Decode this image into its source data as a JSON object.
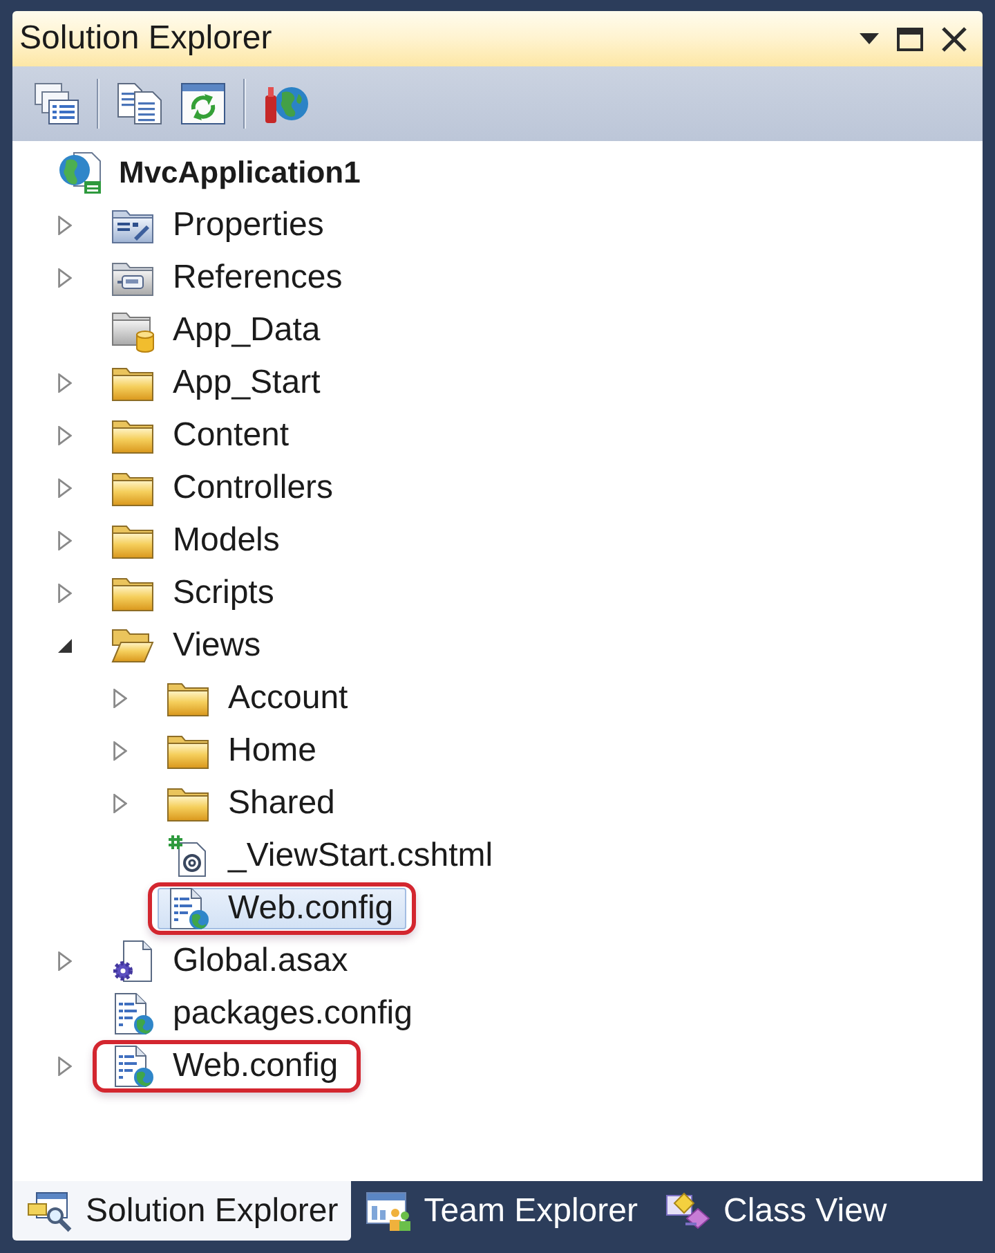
{
  "title_bar": {
    "title": "Solution Explorer"
  },
  "tree": {
    "label": "MvcApplication1",
    "kind": "project",
    "selected": false,
    "highlighted": false,
    "children": [
      {
        "label": "Properties",
        "kind": "properties",
        "expanded": false,
        "selected": false,
        "highlighted": false
      },
      {
        "label": "References",
        "kind": "references",
        "expanded": false,
        "selected": false,
        "highlighted": false
      },
      {
        "label": "App_Data",
        "kind": "data-folder",
        "selected": false,
        "highlighted": false
      },
      {
        "label": "App_Start",
        "kind": "folder",
        "expanded": false,
        "selected": false,
        "highlighted": false
      },
      {
        "label": "Content",
        "kind": "folder",
        "expanded": false,
        "selected": false,
        "highlighted": false
      },
      {
        "label": "Controllers",
        "kind": "folder",
        "expanded": false,
        "selected": false,
        "highlighted": false
      },
      {
        "label": "Models",
        "kind": "folder",
        "expanded": false,
        "selected": false,
        "highlighted": false
      },
      {
        "label": "Scripts",
        "kind": "folder",
        "expanded": false,
        "selected": false,
        "highlighted": false
      },
      {
        "label": "Views",
        "kind": "folder",
        "expanded": true,
        "selected": false,
        "highlighted": false,
        "children": [
          {
            "label": "Account",
            "kind": "folder",
            "expanded": false,
            "selected": false,
            "highlighted": false
          },
          {
            "label": "Home",
            "kind": "folder",
            "expanded": false,
            "selected": false,
            "highlighted": false
          },
          {
            "label": "Shared",
            "kind": "folder",
            "expanded": false,
            "selected": false,
            "highlighted": false
          },
          {
            "label": "_ViewStart.cshtml",
            "kind": "razor-file",
            "selected": false,
            "highlighted": false
          },
          {
            "label": "Web.config",
            "kind": "config-file",
            "selected": true,
            "highlighted": true
          }
        ]
      },
      {
        "label": "Global.asax",
        "kind": "asax-file",
        "expanded": false,
        "selected": false,
        "highlighted": false
      },
      {
        "label": "packages.config",
        "kind": "config-file",
        "selected": false,
        "highlighted": false
      },
      {
        "label": "Web.config",
        "kind": "config-file",
        "expanded": false,
        "selected": false,
        "highlighted": true
      }
    ]
  },
  "bottom_tabs": [
    {
      "label": "Solution Explorer",
      "kind": "solution",
      "selected": true
    },
    {
      "label": "Team Explorer",
      "kind": "team",
      "selected": false
    },
    {
      "label": "Class View",
      "kind": "class",
      "selected": false
    }
  ]
}
